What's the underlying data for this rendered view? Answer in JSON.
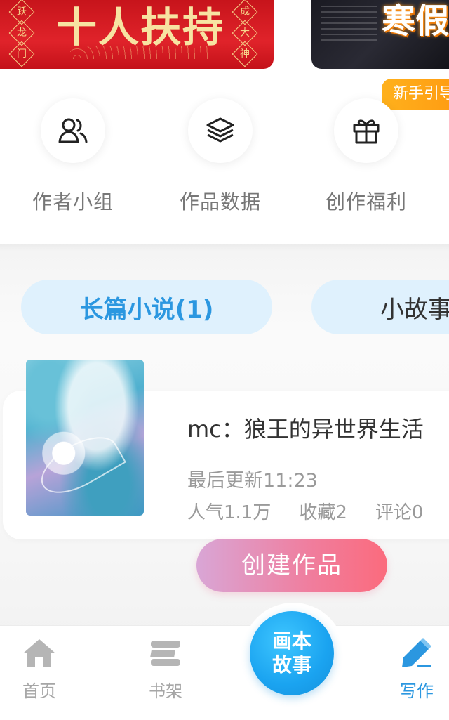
{
  "banners": {
    "red": {
      "slogan": "十人扶持",
      "left_chars": [
        "跃",
        "龙",
        "门"
      ],
      "right_chars": [
        "成",
        "大",
        "神"
      ]
    },
    "dark": {
      "text_top": "寒假",
      "text_bottom": "寒假"
    },
    "newbie_tag": "新手引导"
  },
  "features": [
    {
      "label": "作者小组",
      "icon": "users-icon"
    },
    {
      "label": "作品数据",
      "icon": "layers-icon"
    },
    {
      "label": "创作福利",
      "icon": "gift-icon"
    }
  ],
  "tabs": {
    "long": "长篇小说(1)",
    "short": "小故事"
  },
  "work": {
    "title": "mc：狼王的异世界生活",
    "updated": "最后更新11:23",
    "popularity": "人气1.1万",
    "favorites": "收藏2",
    "comments": "评论0"
  },
  "create_button": "创建作品",
  "bottom_nav": {
    "home": "首页",
    "shelf": "书架",
    "center_line1": "画本",
    "center_line2": "故事",
    "write": "写作"
  },
  "colors": {
    "accent_blue": "#2b97e0",
    "tab_bg": "#dff1fd",
    "create_gradient_start": "#d9a6d6",
    "create_gradient_end": "#fb6b7d",
    "newbie_orange": "#ff9b12"
  }
}
